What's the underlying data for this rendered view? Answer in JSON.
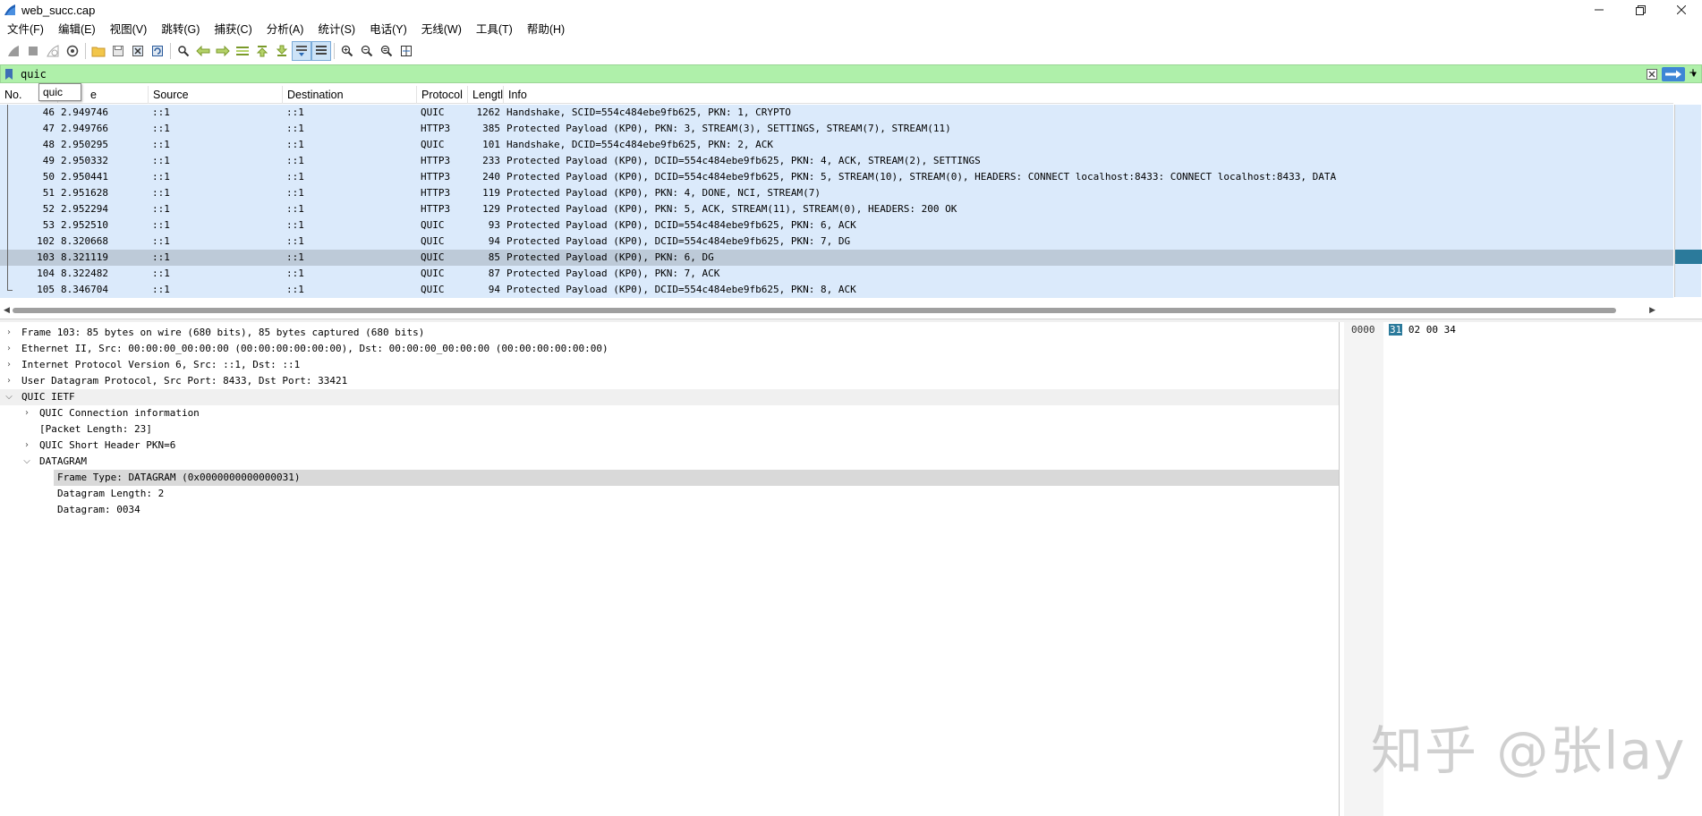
{
  "window": {
    "title": "web_succ.cap",
    "buttons": [
      "minimize",
      "maximize",
      "close"
    ]
  },
  "menu": [
    "文件(F)",
    "编辑(E)",
    "视图(V)",
    "跳转(G)",
    "捕获(C)",
    "分析(A)",
    "统计(S)",
    "电话(Y)",
    "无线(W)",
    "工具(T)",
    "帮助(H)"
  ],
  "toolbar": {
    "icons": [
      "shark-fin-start-icon",
      "stop-square-icon",
      "restart-fin-icon",
      "capture-options-gear-icon",
      "open-folder-icon",
      "save-file-icon",
      "close-file-icon",
      "reload-icon",
      "find-magnifier-icon",
      "go-back-arrow-icon",
      "go-forward-arrow-icon",
      "go-to-packet-icon",
      "go-first-icon",
      "go-last-icon",
      "autoscroll-icon",
      "colorize-icon",
      "zoom-in-icon",
      "zoom-out-icon",
      "zoom-normal-icon",
      "resize-columns-icon"
    ]
  },
  "filter": {
    "value": "quic",
    "autocomplete": "quic",
    "colors": {
      "valid_bg": "#aff0aa",
      "apply_btn": "#3e86d6"
    }
  },
  "packet_list": {
    "columns": [
      "No.",
      "Time",
      "Source",
      "Destination",
      "Protocol",
      "Length",
      "Info"
    ],
    "header_visible": [
      "No.",
      "e",
      "Source",
      "Destination",
      "Protocol",
      "Lengtl",
      "Info"
    ],
    "rows": [
      {
        "no": "46",
        "time": "2.949746",
        "src": "::1",
        "dst": "::1",
        "proto": "QUIC",
        "len": "1262",
        "info": "Handshake, SCID=554c484ebe9fb625, PKN: 1, CRYPTO"
      },
      {
        "no": "47",
        "time": "2.949766",
        "src": "::1",
        "dst": "::1",
        "proto": "HTTP3",
        "len": "385",
        "info": "Protected Payload (KP0), PKN: 3, STREAM(3), SETTINGS, STREAM(7), STREAM(11)"
      },
      {
        "no": "48",
        "time": "2.950295",
        "src": "::1",
        "dst": "::1",
        "proto": "QUIC",
        "len": "101",
        "info": "Handshake, DCID=554c484ebe9fb625, PKN: 2, ACK"
      },
      {
        "no": "49",
        "time": "2.950332",
        "src": "::1",
        "dst": "::1",
        "proto": "HTTP3",
        "len": "233",
        "info": "Protected Payload (KP0), DCID=554c484ebe9fb625, PKN: 4, ACK, STREAM(2), SETTINGS"
      },
      {
        "no": "50",
        "time": "2.950441",
        "src": "::1",
        "dst": "::1",
        "proto": "HTTP3",
        "len": "240",
        "info": "Protected Payload (KP0), DCID=554c484ebe9fb625, PKN: 5, STREAM(10), STREAM(0), HEADERS: CONNECT localhost:8433: CONNECT localhost:8433, DATA"
      },
      {
        "no": "51",
        "time": "2.951628",
        "src": "::1",
        "dst": "::1",
        "proto": "HTTP3",
        "len": "119",
        "info": "Protected Payload (KP0), PKN: 4, DONE, NCI, STREAM(7)"
      },
      {
        "no": "52",
        "time": "2.952294",
        "src": "::1",
        "dst": "::1",
        "proto": "HTTP3",
        "len": "129",
        "info": "Protected Payload (KP0), PKN: 5, ACK, STREAM(11), STREAM(0), HEADERS: 200 OK"
      },
      {
        "no": "53",
        "time": "2.952510",
        "src": "::1",
        "dst": "::1",
        "proto": "QUIC",
        "len": "93",
        "info": "Protected Payload (KP0), DCID=554c484ebe9fb625, PKN: 6, ACK"
      },
      {
        "no": "102",
        "time": "8.320668",
        "src": "::1",
        "dst": "::1",
        "proto": "QUIC",
        "len": "94",
        "info": "Protected Payload (KP0), DCID=554c484ebe9fb625, PKN: 7, DG"
      },
      {
        "no": "103",
        "time": "8.321119",
        "src": "::1",
        "dst": "::1",
        "proto": "QUIC",
        "len": "85",
        "info": "Protected Payload (KP0), PKN: 6, DG",
        "selected": true
      },
      {
        "no": "104",
        "time": "8.322482",
        "src": "::1",
        "dst": "::1",
        "proto": "QUIC",
        "len": "87",
        "info": "Protected Payload (KP0), PKN: 7, ACK"
      },
      {
        "no": "105",
        "time": "8.346704",
        "src": "::1",
        "dst": "::1",
        "proto": "QUIC",
        "len": "94",
        "info": "Protected Payload (KP0), DCID=554c484ebe9fb625, PKN: 8, ACK"
      }
    ],
    "colors": {
      "row_bg": "#dbeafb",
      "selected_bg": "#bdcad8",
      "minimap_sel": "#2b7a9b"
    }
  },
  "details": [
    {
      "text": "Frame 103: 85 bytes on wire (680 bits), 85 bytes captured (680 bits)",
      "level": 0,
      "toggle": "collapsed"
    },
    {
      "text": "Ethernet II, Src: 00:00:00_00:00:00 (00:00:00:00:00:00), Dst: 00:00:00_00:00:00 (00:00:00:00:00:00)",
      "level": 0,
      "toggle": "collapsed"
    },
    {
      "text": "Internet Protocol Version 6, Src: ::1, Dst: ::1",
      "level": 0,
      "toggle": "collapsed"
    },
    {
      "text": "User Datagram Protocol, Src Port: 8433, Dst Port: 33421",
      "level": 0,
      "toggle": "collapsed"
    },
    {
      "text": "QUIC IETF",
      "level": 0,
      "toggle": "expanded",
      "highlight": "light"
    },
    {
      "text": "QUIC Connection information",
      "level": 1,
      "toggle": "collapsed"
    },
    {
      "text": "[Packet Length: 23]",
      "level": 1,
      "toggle": "none"
    },
    {
      "text": "QUIC Short Header PKN=6",
      "level": 1,
      "toggle": "collapsed"
    },
    {
      "text": "DATAGRAM",
      "level": 1,
      "toggle": "expanded"
    },
    {
      "text": "Frame Type: DATAGRAM (0x0000000000000031)",
      "level": 2,
      "toggle": "none",
      "highlight": "selected"
    },
    {
      "text": "Datagram Length: 2",
      "level": 2,
      "toggle": "none"
    },
    {
      "text": "Datagram: 0034",
      "level": 2,
      "toggle": "none"
    }
  ],
  "bytes": {
    "offset": "0000",
    "hex_selected": "31",
    "hex_rest": " 02 00 34"
  },
  "watermark": "知乎 @张lay"
}
